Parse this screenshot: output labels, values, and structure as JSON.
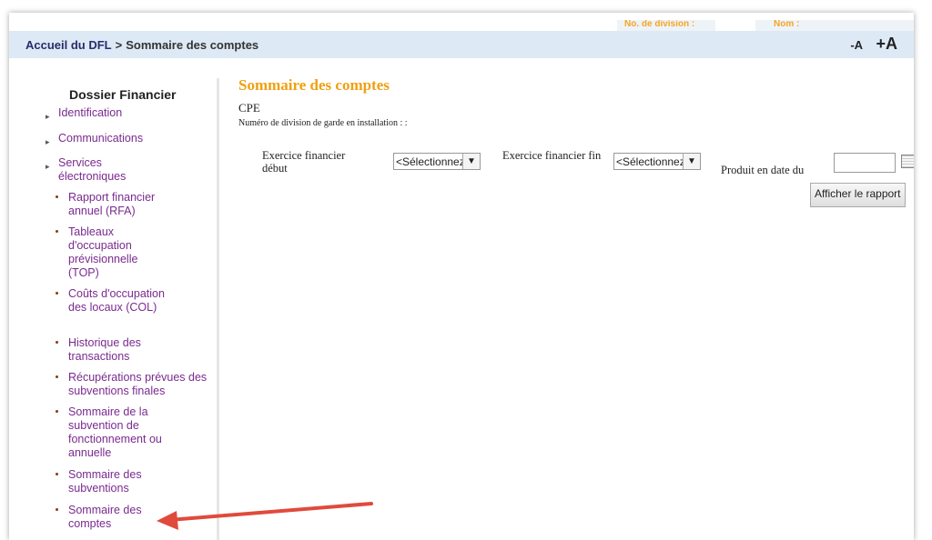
{
  "top_tabs": {
    "division_label": "No. de division :",
    "nom_label": "Nom :"
  },
  "breadcrumb": {
    "home": "Accueil du DFL",
    "separator": ">",
    "current": "Sommaire des comptes"
  },
  "font_controls": {
    "decrease": "-A",
    "increase": "+A"
  },
  "sidebar": {
    "title": "Dossier Financier",
    "items": [
      {
        "label": "Identification"
      },
      {
        "label": "Communications"
      },
      {
        "label": "Services électroniques"
      }
    ],
    "sub_items": [
      {
        "label": "Rapport financier annuel (RFA)"
      },
      {
        "label": "Tableaux d'occupation prévisionnelle (TOP)"
      },
      {
        "label": "Coûts d'occupation des locaux (COL)"
      },
      {
        "label": "Historique des transactions"
      },
      {
        "label": "Récupérations prévues des subventions finales"
      },
      {
        "label": "Sommaire de la subvention de fonctionnement ou annuelle"
      },
      {
        "label": "Sommaire des subventions"
      },
      {
        "label": "Sommaire des comptes"
      }
    ]
  },
  "main": {
    "title": "Sommaire des comptes",
    "subtitle": "CPE",
    "division_line": "Numéro de division de garde en installation : :",
    "filters": {
      "exercise_start_label": "Exercice financier début",
      "exercise_start_value": "<Sélectionnez>",
      "exercise_end_label": "Exercice financier fin",
      "exercise_end_value": "<Sélectionnez>",
      "date_label": "Produit en date du",
      "date_value": ""
    },
    "show_report_button": "Afficher le rapport"
  },
  "colors": {
    "accent_title": "#f0a010",
    "nav_link": "#7a2a8f",
    "header_bg": "#dde9f5",
    "annotation_arrow": "#e04a3c"
  },
  "icons": {
    "calendar": "calendar-icon",
    "dropdown": "chevron-down-icon"
  }
}
